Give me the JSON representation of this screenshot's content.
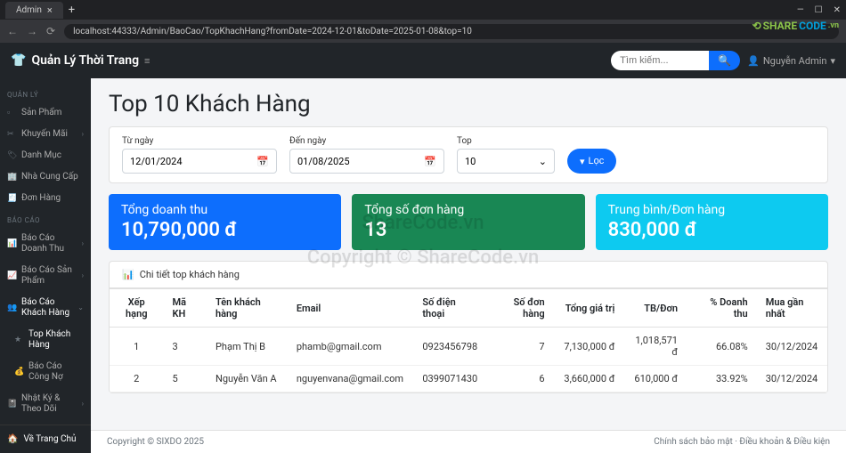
{
  "browser": {
    "tab_title": "Admin",
    "url": "localhost:44333/Admin/BaoCao/TopKhachHang?fromDate=2024-12-01&toDate=2025-01-08&top=10",
    "watermark": "SHARECODE.vn"
  },
  "topbar": {
    "brand": "Quản Lý Thời Trang",
    "search_placeholder": "Tìm kiếm...",
    "user": "Nguyễn Admin"
  },
  "sidebar": {
    "heading_manage": "QUẢN LÝ",
    "items_manage": [
      {
        "label": "Sản Phẩm"
      },
      {
        "label": "Khuyến Mãi",
        "chev": true
      },
      {
        "label": "Danh Mục"
      },
      {
        "label": "Nhà Cung Cấp"
      },
      {
        "label": "Đơn Hàng"
      }
    ],
    "heading_report": "BÁO CÁO",
    "items_report": [
      {
        "label": "Báo Cáo Doanh Thu",
        "chev": true
      },
      {
        "label": "Báo Cáo Sản Phẩm",
        "chev": true
      },
      {
        "label": "Báo Cáo Khách Hàng",
        "chev": true,
        "active": true
      },
      {
        "label": "Top Khách Hàng",
        "sub": true
      },
      {
        "label": "Báo Cáo Công Nợ",
        "sub": true
      },
      {
        "label": "Nhật Ký & Theo Dõi",
        "chev": true
      }
    ],
    "home": "Về Trang Chủ"
  },
  "page_title": "Top 10 Khách Hàng",
  "filters": {
    "from_label": "Từ ngày",
    "from_value": "12/01/2024",
    "to_label": "Đến ngày",
    "to_value": "01/08/2025",
    "top_label": "Top",
    "top_value": "10",
    "filter_btn": "Lọc"
  },
  "stats": [
    {
      "label": "Tổng doanh thu",
      "value": "10,790,000 đ"
    },
    {
      "label": "Tổng số đơn hàng",
      "value": "13"
    },
    {
      "label": "Trung bình/Đơn hàng",
      "value": "830,000 đ"
    }
  ],
  "table": {
    "title": "Chi tiết top khách hàng",
    "headers": [
      "Xếp hạng",
      "Mã KH",
      "Tên khách hàng",
      "Email",
      "Số điện thoại",
      "Số đơn hàng",
      "Tổng giá trị",
      "TB/Đơn",
      "% Doanh thu",
      "Mua gần nhất"
    ],
    "rows": [
      {
        "rank": "1",
        "id": "3",
        "name": "Phạm Thị B",
        "email": "phamb@gmail.com",
        "phone": "0923456798",
        "orders": "7",
        "total": "7,130,000 đ",
        "avg": "1,018,571 đ",
        "pct": "66.08%",
        "last": "30/12/2024"
      },
      {
        "rank": "2",
        "id": "5",
        "name": "Nguyễn Văn A",
        "email": "nguyenvana@gmail.com",
        "phone": "0399071430",
        "orders": "6",
        "total": "3,660,000 đ",
        "avg": "610,000 đ",
        "pct": "33.92%",
        "last": "30/12/2024"
      }
    ]
  },
  "footer": {
    "copyright": "Copyright © SIXDO 2025",
    "links": "Chính sách bảo mật · Điều khoản & Điều kiện"
  },
  "center_watermark_1": "ShareCode.vn",
  "center_watermark_2": "Copyright © ShareCode.vn"
}
